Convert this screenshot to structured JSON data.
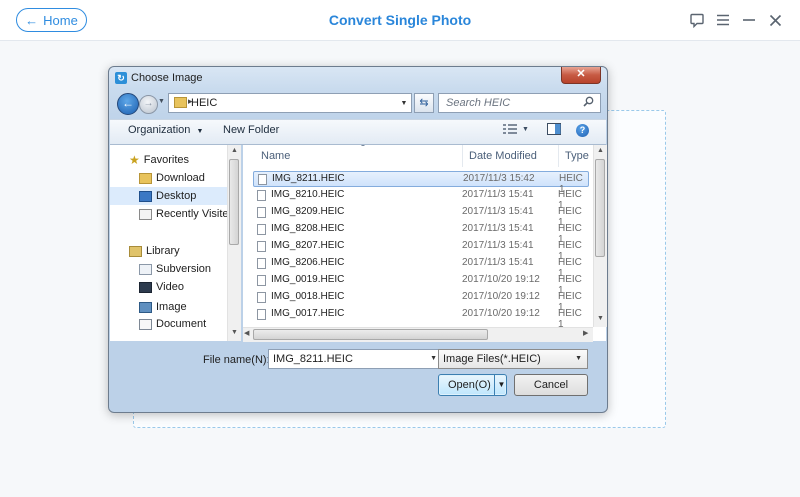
{
  "app": {
    "home_label": "Home",
    "title": "Convert Single Photo",
    "icons": [
      "feedback-icon",
      "menu-icon",
      "minimize-icon",
      "close-icon"
    ]
  },
  "dialog": {
    "title": "Choose Image",
    "address_path": "HEIC",
    "search_placeholder": "Search HEIC",
    "toolbar": {
      "organize": "Organization",
      "new_folder": "New Folder"
    },
    "nav": {
      "favorites": "Favorites",
      "download": "Download",
      "desktop": "Desktop",
      "recently_visited": "Recently Visited",
      "library": "Library",
      "subversion": "Subversion",
      "video": "Video",
      "image": "Image",
      "document": "Document"
    },
    "columns": {
      "name": "Name",
      "date_modified": "Date Modified",
      "type": "Type"
    },
    "files": [
      {
        "name": "IMG_8211.HEIC",
        "date": "2017/11/3 15:42",
        "type": "HEIC 1"
      },
      {
        "name": "IMG_8210.HEIC",
        "date": "2017/11/3 15:41",
        "type": "HEIC 1"
      },
      {
        "name": "IMG_8209.HEIC",
        "date": "2017/11/3 15:41",
        "type": "HEIC 1"
      },
      {
        "name": "IMG_8208.HEIC",
        "date": "2017/11/3 15:41",
        "type": "HEIC 1"
      },
      {
        "name": "IMG_8207.HEIC",
        "date": "2017/11/3 15:41",
        "type": "HEIC 1"
      },
      {
        "name": "IMG_8206.HEIC",
        "date": "2017/11/3 15:41",
        "type": "HEIC 1"
      },
      {
        "name": "IMG_0019.HEIC",
        "date": "2017/10/20 19:12",
        "type": "HEIC 1"
      },
      {
        "name": "IMG_0018.HEIC",
        "date": "2017/10/20 19:12",
        "type": "HEIC 1"
      },
      {
        "name": "IMG_0017.HEIC",
        "date": "2017/10/20 19:12",
        "type": "HEIC 1"
      }
    ],
    "file_name_label": "File name(N):",
    "file_name_value": "IMG_8211.HEIC",
    "file_type_value": "Image Files(*.HEIC)",
    "open_label": "Open(O)",
    "cancel_label": "Cancel"
  },
  "colors": {
    "accent": "#2a86da",
    "selection": "#cfe3fb"
  }
}
